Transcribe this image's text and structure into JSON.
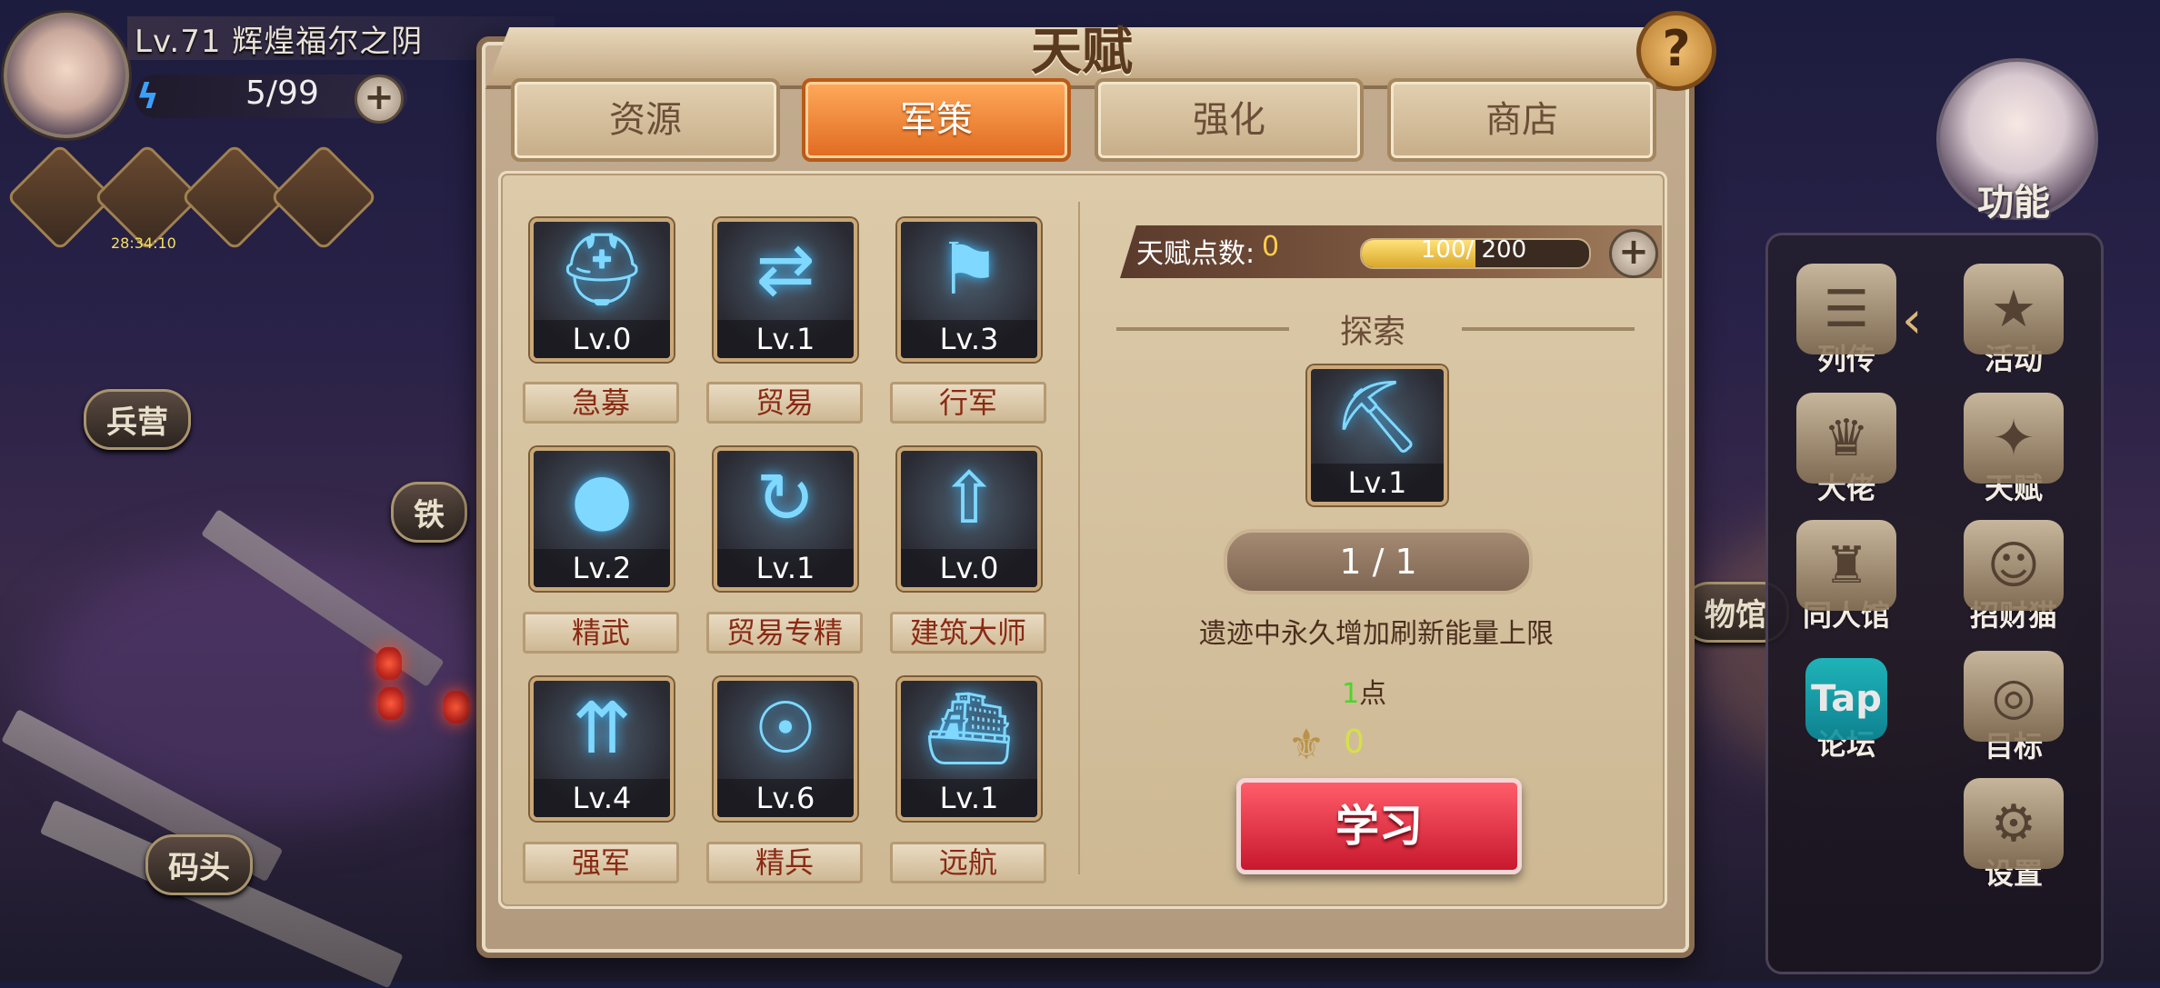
{
  "player": {
    "level_name": "Lv.71  辉煌福尔之阴",
    "energy": "5/99",
    "buff_timer": "28:34:10",
    "buff_icons": [
      "scroll-icon",
      "firework-icon",
      "helmet-icon",
      "crab-icon"
    ]
  },
  "map_labels": {
    "barracks": "兵营",
    "iron": "铁",
    "dock": "码头",
    "museum": "物馆"
  },
  "dialog": {
    "title": "天赋",
    "tabs": [
      {
        "label": "资源",
        "active": false
      },
      {
        "label": "军策",
        "active": true
      },
      {
        "label": "强化",
        "active": false
      },
      {
        "label": "商店",
        "active": false
      }
    ],
    "skills": [
      {
        "level": "Lv.0",
        "name": "急募",
        "icon": "stamina-icon"
      },
      {
        "level": "Lv.1",
        "name": "贸易",
        "icon": "trade-icon"
      },
      {
        "level": "Lv.3",
        "name": "行军",
        "icon": "flag-icon"
      },
      {
        "level": "Lv.2",
        "name": "精武",
        "icon": "orbs-icon"
      },
      {
        "level": "Lv.1",
        "name": "贸易专精",
        "icon": "trade-master-icon"
      },
      {
        "level": "Lv.0",
        "name": "建筑大师",
        "icon": "building-icon"
      },
      {
        "level": "Lv.4",
        "name": "强军",
        "icon": "power-up-icon"
      },
      {
        "level": "Lv.6",
        "name": "精兵",
        "icon": "elite-soldier-icon"
      },
      {
        "level": "Lv.1",
        "name": "远航",
        "icon": "ship-icon"
      }
    ],
    "talent_points_label": "天赋点数:",
    "talent_points": "0",
    "progress_text": "100/ 200",
    "progress_fraction": 0.5,
    "section_title": "探索",
    "selected": {
      "level": "Lv.1",
      "icon": "explore-icon"
    },
    "count": "1 / 1",
    "description": "遗迹中永久增加刷新能量上限",
    "cost_num": "1",
    "cost_unit": "点",
    "badge_value": "0",
    "learn_label": "学习"
  },
  "functions": {
    "main_label": "功能",
    "items": [
      {
        "label": "列传",
        "icon": "scroll-book-icon"
      },
      {
        "label": "活动",
        "icon": "star-medal-icon"
      },
      {
        "label": "大佬",
        "icon": "crown-boss-icon"
      },
      {
        "label": "天赋",
        "icon": "talent-icon"
      },
      {
        "label": "同人馆",
        "icon": "castle-icon"
      },
      {
        "label": "招财猫",
        "icon": "lucky-cat-icon"
      },
      {
        "label": "论坛",
        "icon": "tap-forum-icon",
        "badge": "Tap"
      },
      {
        "label": "目标",
        "icon": "target-icon"
      },
      {
        "label": "设置",
        "icon": "gear-icon"
      }
    ]
  },
  "colors": {
    "accent_orange": "#e06a20",
    "learn_red": "#c8182e",
    "points_yellow": "#ffcf4a",
    "cost_green": "#4ad62a"
  }
}
